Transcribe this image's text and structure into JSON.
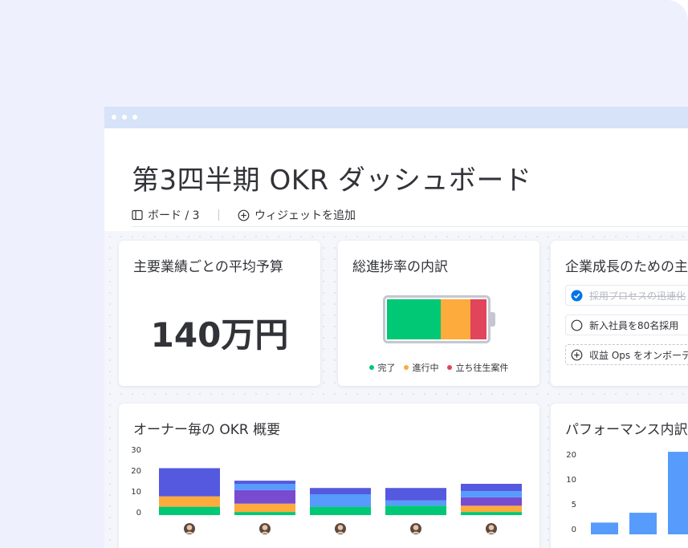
{
  "window": {
    "title": "第3四半期 OKR ダッシュボード",
    "toolbar": {
      "board_label": "ボード / 3",
      "add_widget_label": "ウィジェットを追加"
    }
  },
  "widgets": {
    "avg_budget": {
      "title": "主要業績ごとの平均予算",
      "value": "140万円"
    },
    "progress": {
      "title": "総進捗率の内訳",
      "legend": [
        {
          "label": "完了",
          "color": "#00c875"
        },
        {
          "label": "進行中",
          "color": "#fdab3d"
        },
        {
          "label": "立ち往生案件",
          "color": "#e2445c"
        }
      ]
    },
    "growth": {
      "title": "企業成長のための主要業績",
      "items": [
        {
          "label": "採用プロセスの迅速化",
          "checked": true
        },
        {
          "label": "新入社員を80名採用",
          "checked": false
        },
        {
          "label": "収益 Ops をオンボーディング",
          "add": true
        }
      ]
    },
    "owner_chart": {
      "title": "オーナー毎の OKR 概要"
    },
    "performance": {
      "title": "パフォーマンス内訳"
    }
  },
  "colors": {
    "done": "#00c875",
    "working": "#fdab3d",
    "stuck": "#e2445c",
    "purple": "#784bd1",
    "indigo": "#5559df",
    "blue": "#579bfc",
    "checked": "#0073ea"
  },
  "chart_data": [
    {
      "type": "bar",
      "stacked": true,
      "title": "オーナー毎の OKR 概要",
      "categories": [
        "owner-1",
        "owner-2",
        "owner-3",
        "owner-4",
        "owner-5"
      ],
      "y_ticks": [
        "30",
        "20",
        "10",
        "0"
      ],
      "ylim": [
        0,
        30
      ],
      "series": [
        {
          "color": "#00c875",
          "values": [
            4,
            1.5,
            4,
            4.5,
            1.5
          ]
        },
        {
          "color": "#fdab3d",
          "values": [
            5,
            4,
            0,
            0,
            3
          ]
        },
        {
          "color": "#784bd1",
          "values": [
            0,
            6.5,
            0,
            0,
            4
          ]
        },
        {
          "color": "#579bfc",
          "values": [
            0,
            3,
            6,
            2.5,
            3
          ]
        },
        {
          "color": "#5559df",
          "values": [
            13.5,
            1.5,
            3,
            6,
            3.5
          ]
        }
      ],
      "avatars": [
        "avatar-1",
        "avatar-2",
        "avatar-3",
        "avatar-4",
        "avatar-5"
      ]
    },
    {
      "type": "bar",
      "title": "パフォーマンス内訳",
      "y_ticks": [
        "20",
        "10",
        "5",
        "0"
      ],
      "values": [
        3,
        5.5,
        21
      ],
      "ylim": [
        0,
        20
      ],
      "color": "#579bfc"
    }
  ]
}
